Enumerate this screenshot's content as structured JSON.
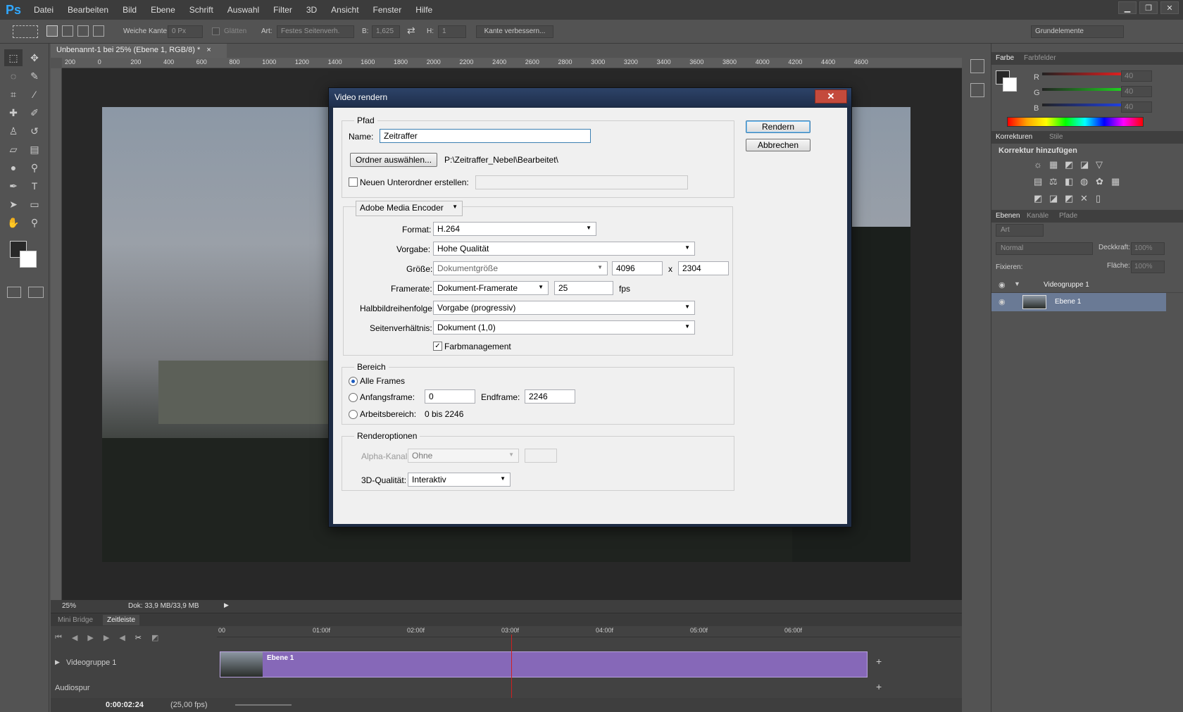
{
  "app": {
    "logo": "Ps"
  },
  "menu": [
    "Datei",
    "Bearbeiten",
    "Bild",
    "Ebene",
    "Schrift",
    "Auswahl",
    "Filter",
    "3D",
    "Ansicht",
    "Fenster",
    "Hilfe"
  ],
  "window_controls": {
    "min": "▁",
    "max": "❐",
    "close": "✕"
  },
  "options": {
    "feather_label": "Weiche Kante:",
    "feather_value": "0 Px",
    "antialias_label": "Glätten",
    "style_label": "Art:",
    "style_value": "Festes Seitenverh.",
    "width_label": "B:",
    "width_value": "1,625",
    "height_label": "H:",
    "height_value": "1",
    "refine_label": "Kante verbessern...",
    "workspace": "Grundelemente"
  },
  "document": {
    "tab_title": "Unbenannt-1 bei 25% (Ebene 1, RGB/8) *",
    "tab_close": "×",
    "zoom": "25%",
    "doc_size": "Dok: 33,9 MB/33,9 MB"
  },
  "ruler_ticks": [
    "200",
    "0",
    "200",
    "400",
    "600",
    "800",
    "1000",
    "1200",
    "1400",
    "1600",
    "1800",
    "2000",
    "2200",
    "2400",
    "2600",
    "2800",
    "3000",
    "3200",
    "3400",
    "3600",
    "3800",
    "4000",
    "4200",
    "4400",
    "4600"
  ],
  "dialog": {
    "title": "Video rendern",
    "close": "✕",
    "path_group": "Pfad",
    "name_label": "Name:",
    "name_value": "Zeitraffer",
    "choose_folder": "Ordner auswählen...",
    "folder_path": "P:\\Zeitraffer_Nebel\\Bearbeitet\\",
    "subfolder_label": "Neuen Unterordner erstellen:",
    "encoder": "Adobe Media Encoder",
    "format_label": "Format:",
    "format_value": "H.264",
    "preset_label": "Vorgabe:",
    "preset_value": "Hohe Qualität",
    "size_label": "Größe:",
    "size_value": "Dokumentgröße",
    "width": "4096",
    "x": "x",
    "height": "2304",
    "framerate_label": "Framerate:",
    "framerate_value": "Dokument-Framerate",
    "fps_value": "25",
    "fps_unit": "fps",
    "field_label": "Halbbildreihenfolge:",
    "field_value": "Vorgabe (progressiv)",
    "aspect_label": "Seitenverhältnis:",
    "aspect_value": "Dokument (1,0)",
    "color_mgmt": "Farbmanagement",
    "range_group": "Bereich",
    "all_frames": "Alle Frames",
    "start_label": "Anfangsframe:",
    "start_value": "0",
    "end_label": "Endframe:",
    "end_value": "2246",
    "work_label": "Arbeitsbereich:",
    "work_value": "0 bis 2246",
    "render_group": "Renderoptionen",
    "alpha_label": "Alpha-Kanal:",
    "alpha_value": "Ohne",
    "quality_label": "3D-Qualität:",
    "quality_value": "Interaktiv",
    "render_btn": "Rendern",
    "cancel_btn": "Abbrechen"
  },
  "timeline": {
    "tab_minibridge": "Mini Bridge",
    "tab_timeline": "Zeitleiste",
    "ticks": [
      "00",
      "01:00f",
      "02:00f",
      "03:00f",
      "04:00f",
      "05:00f",
      "06:00f"
    ],
    "group_name": "Videogruppe 1",
    "clip_name": "Ebene 1",
    "audio": "Audiospur",
    "timecode": "0:00:02:24",
    "fps": "(25,00 fps)",
    "playhead_fraction": 0.43
  },
  "panels": {
    "color_tab": "Farbe",
    "swatches_tab": "Farbfelder",
    "r_label": "R",
    "g_label": "G",
    "b_label": "B",
    "r_value": "40",
    "g_value": "40",
    "b_value": "40",
    "adj_tab": "Korrekturen",
    "styles_tab": "Stile",
    "adj_title": "Korrektur hinzufügen",
    "layers_tab": "Ebenen",
    "channels_tab": "Kanäle",
    "paths_tab": "Pfade",
    "filter_kind": "Art",
    "blend_mode": "Normal",
    "opacity_label": "Deckkraft:",
    "opacity_value": "100%",
    "lock_label": "Fixieren:",
    "fill_label": "Fläche:",
    "fill_value": "100%",
    "layer_group": "Videogruppe 1",
    "layer_1": "Ebene 1"
  }
}
